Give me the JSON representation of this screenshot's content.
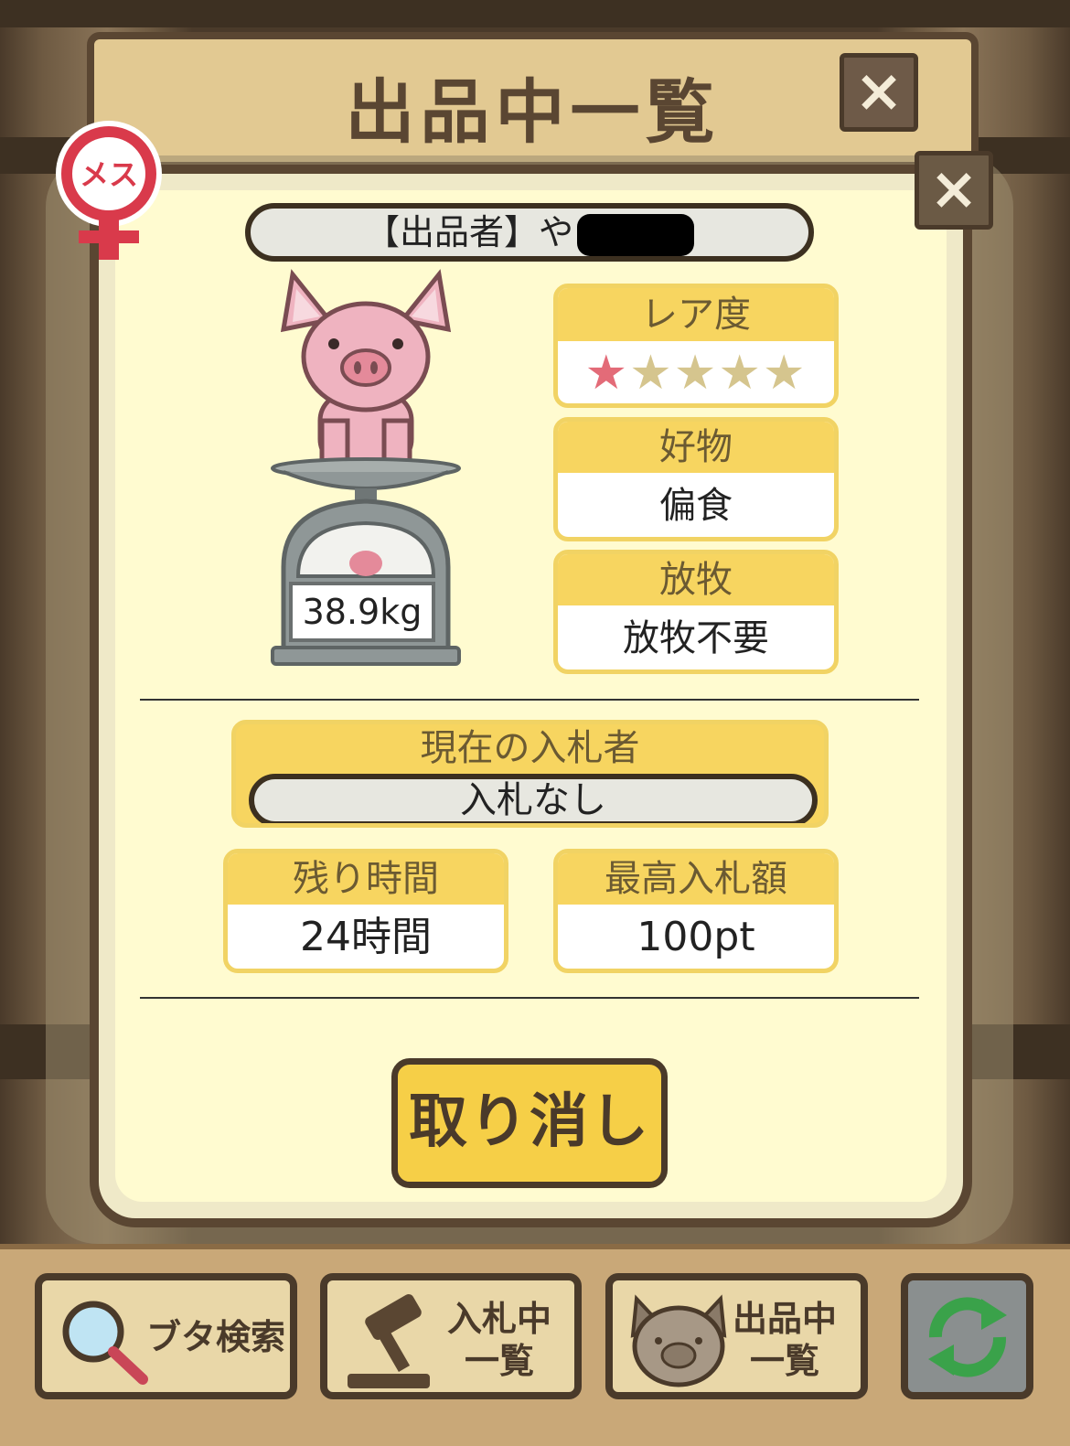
{
  "header": {
    "title": "出品中一覧",
    "close_label": "×"
  },
  "dialog": {
    "close_label": "×",
    "gender_badge": "メス",
    "seller_label": "【出品者】や",
    "rarity": {
      "label": "レア度",
      "stars_filled": 1,
      "stars_total": 5,
      "stars": "★★★★★"
    },
    "favorite": {
      "label": "好物",
      "value": "偏食"
    },
    "grazing": {
      "label": "放牧",
      "value": "放牧不要"
    },
    "weight": "38.9kg",
    "bidder": {
      "label": "現在の入札者",
      "value": "入札なし"
    },
    "time_left": {
      "label": "残り時間",
      "value": "24時間"
    },
    "top_bid": {
      "label": "最高入札額",
      "value": "100pt"
    },
    "cancel_label": "取り消し"
  },
  "nav": {
    "search_label": "ブタ検索",
    "bidding_line1": "入札中",
    "bidding_line2": "一覧",
    "listing_line1": "出品中",
    "listing_line2": "一覧"
  },
  "colors": {
    "accent": "#f7d560",
    "frame": "#5a4632",
    "panel": "#fffbd0"
  }
}
